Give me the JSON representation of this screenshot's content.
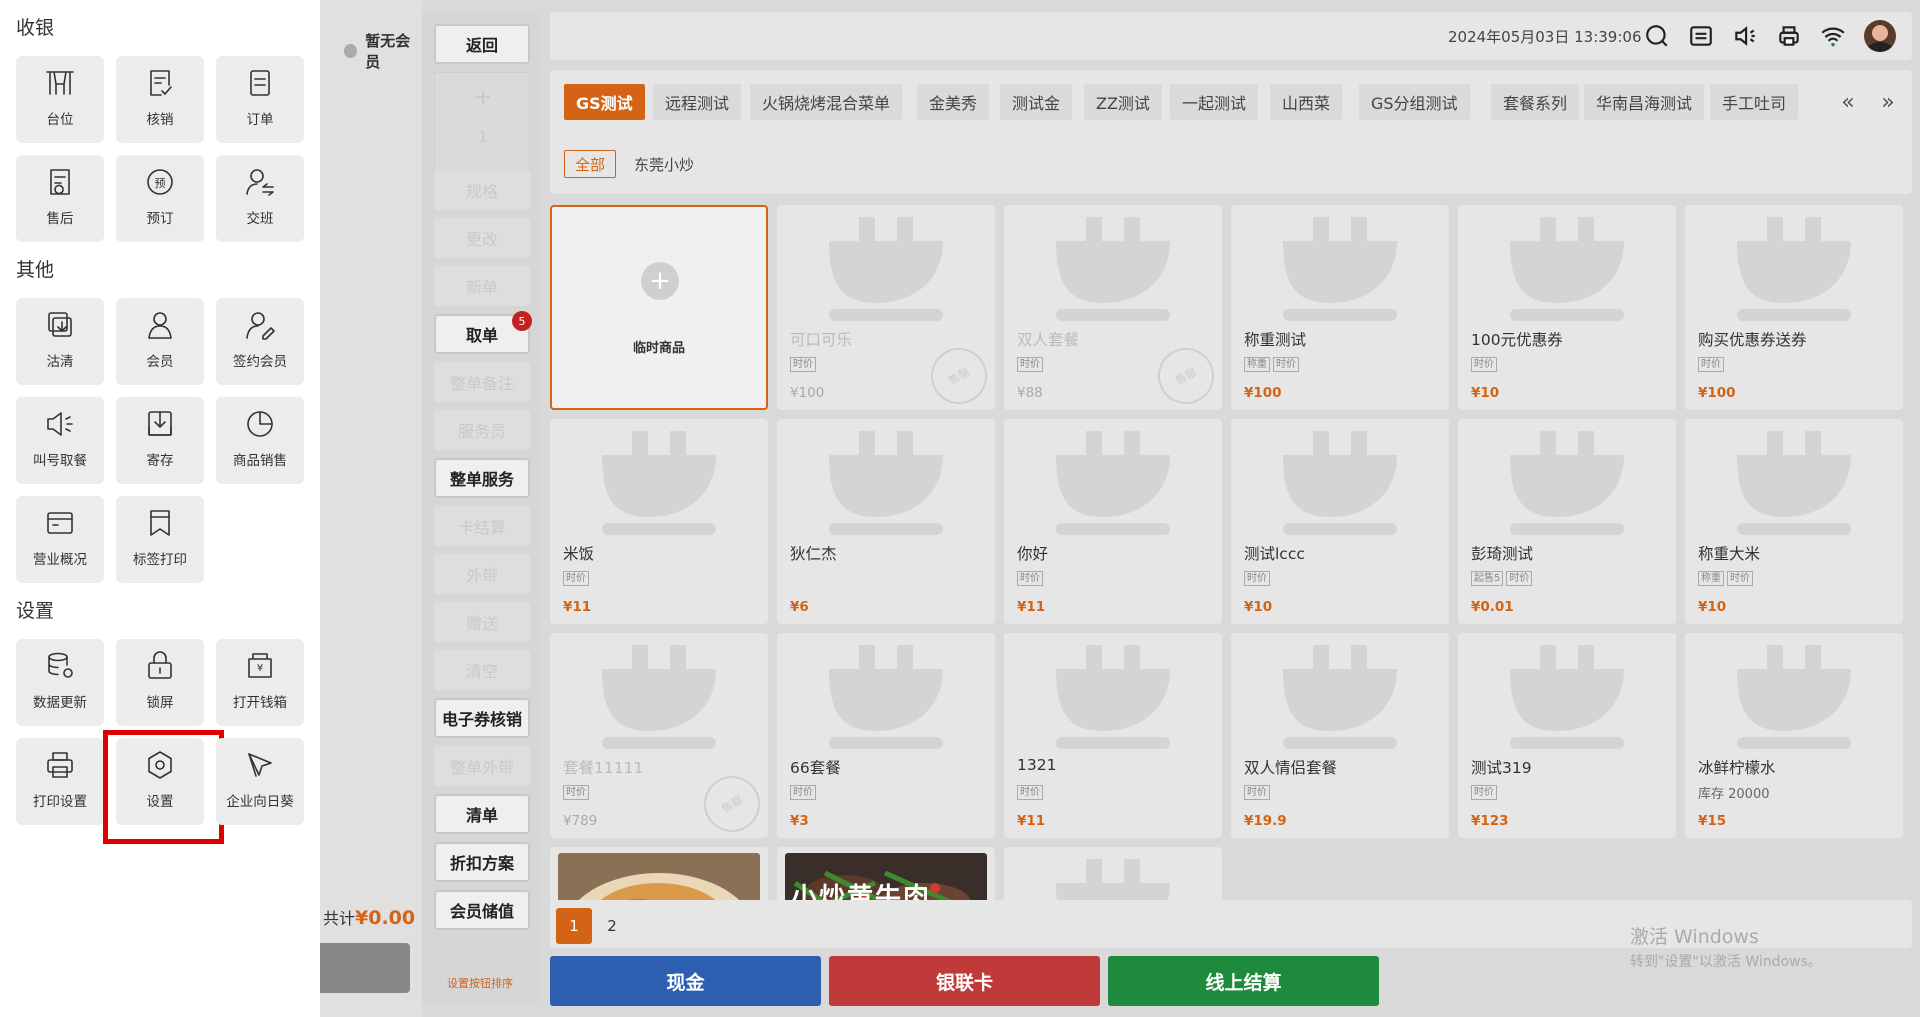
{
  "drawer": {
    "sections": [
      {
        "title": "收银",
        "items": [
          {
            "label": "台位",
            "icon": "table-chair-icon"
          },
          {
            "label": "核销",
            "icon": "verify-icon"
          },
          {
            "label": "订单",
            "icon": "order-icon"
          },
          {
            "label": "售后",
            "icon": "after-sale-icon"
          },
          {
            "label": "预订",
            "icon": "reserve-icon"
          },
          {
            "label": "交班",
            "icon": "shift-handover-icon"
          }
        ]
      },
      {
        "title": "其他",
        "items": [
          {
            "label": "沽清",
            "icon": "clear-stock-icon"
          },
          {
            "label": "会员",
            "icon": "member-icon"
          },
          {
            "label": "签约会员",
            "icon": "contract-member-icon"
          },
          {
            "label": "叫号取餐",
            "icon": "call-number-icon"
          },
          {
            "label": "寄存",
            "icon": "storage-icon"
          },
          {
            "label": "商品销售",
            "icon": "sales-chart-icon"
          },
          {
            "label": "营业概况",
            "icon": "business-overview-icon"
          },
          {
            "label": "标签打印",
            "icon": "label-print-icon"
          }
        ]
      },
      {
        "title": "设置",
        "items": [
          {
            "label": "数据更新",
            "icon": "data-update-icon"
          },
          {
            "label": "锁屏",
            "icon": "lock-screen-icon"
          },
          {
            "label": "打开钱箱",
            "icon": "cash-box-icon"
          },
          {
            "label": "打印设置",
            "icon": "printer-icon"
          },
          {
            "label": "设置",
            "icon": "settings-hexagon-icon",
            "highlight": true
          },
          {
            "label": "企业向日葵",
            "icon": "sunflower-remote-icon"
          }
        ]
      }
    ]
  },
  "member": {
    "label": "暂无会员",
    "total_label": "共计",
    "total_value": "¥0.00"
  },
  "ops": {
    "back": "返回",
    "qty_plus": "+",
    "qty_value": "1",
    "buttons": [
      {
        "label": "规格",
        "active": false
      },
      {
        "label": "更改",
        "active": false
      },
      {
        "label": "新单",
        "active": false
      },
      {
        "label": "取单",
        "active": true,
        "badge": "5"
      },
      {
        "label": "整单备注",
        "active": false
      },
      {
        "label": "服务员",
        "active": false
      },
      {
        "label": "整单服务",
        "active": true
      },
      {
        "label": "卡结算",
        "active": false
      },
      {
        "label": "外带",
        "active": false
      },
      {
        "label": "赠送",
        "active": false
      },
      {
        "label": "清空",
        "active": false
      },
      {
        "label": "电子券核销",
        "active": true
      },
      {
        "label": "整单外带",
        "active": false
      },
      {
        "label": "清单",
        "active": true
      },
      {
        "label": "折扣方案",
        "active": true
      },
      {
        "label": "会员储值",
        "active": true
      }
    ],
    "sort_link": "设置按钮排序"
  },
  "topbar": {
    "datetime": "2024年05月03日 13:39:06"
  },
  "categories": [
    "GS测试",
    "远程测试",
    "火锅烧烤混合菜单",
    "金美秀",
    "测试金",
    "ZZ测试",
    "一起测试",
    "山西菜",
    "GS分组测试",
    "套餐系列",
    "华南昌海测试",
    "手工吐司"
  ],
  "subcategories": {
    "active": "全部",
    "other": "东莞小炒"
  },
  "temp_item": "临时商品",
  "items": [
    {
      "name": "可口可乐",
      "tags": [
        "时价"
      ],
      "price": "¥100",
      "sold": true,
      "stamp": "售罄"
    },
    {
      "name": "双人套餐",
      "tags": [
        "时价"
      ],
      "price": "¥88",
      "sold": true,
      "stamp": "售罄"
    },
    {
      "name": "称重测试",
      "tags": [
        "称重",
        "时价"
      ],
      "price": "¥100"
    },
    {
      "name": "100元优惠券",
      "tags": [
        "时价"
      ],
      "price": "¥10"
    },
    {
      "name": "购买优惠券送券",
      "tags": [
        "时价"
      ],
      "price": "¥100"
    },
    {
      "name": "米饭",
      "tags": [
        "时价"
      ],
      "price": "¥11"
    },
    {
      "name": "狄仁杰",
      "tags": [],
      "price": "¥6"
    },
    {
      "name": "你好",
      "tags": [
        "时价"
      ],
      "price": "¥11"
    },
    {
      "name": "测试lccc",
      "tags": [
        "时价"
      ],
      "price": "¥10"
    },
    {
      "name": "彭琦测试",
      "tags": [
        "起售5",
        "时价"
      ],
      "price": "¥0.01"
    },
    {
      "name": "称重大米",
      "tags": [
        "称重",
        "时价"
      ],
      "price": "¥10"
    },
    {
      "name": "套餐11111",
      "tags": [
        "时价"
      ],
      "price": "¥789",
      "sold": true,
      "stamp": "售罄"
    },
    {
      "name": "66套餐",
      "tags": [
        "时价"
      ],
      "price": "¥3"
    },
    {
      "name": "1321",
      "tags": [
        "时价"
      ],
      "price": "¥11"
    },
    {
      "name": "双人情侣套餐",
      "tags": [
        "时价"
      ],
      "price": "¥19.9"
    },
    {
      "name": "测试319",
      "tags": [
        "时价"
      ],
      "price": "¥123"
    },
    {
      "name": "冰鲜柠檬水",
      "tags": [],
      "stock": "库存  20000",
      "price": "¥15"
    }
  ],
  "photo_caption": "小炒黄牛肉",
  "pager": {
    "pages": [
      "1",
      "2"
    ],
    "watermark_title": "激活 Windows",
    "watermark_sub": "转到\"设置\"以激活 Windows。"
  },
  "pay": {
    "cash": "现金",
    "unionpay": "银联卡",
    "online": "线上结算"
  },
  "colors": {
    "accent": "#d36416",
    "cash": "#2d5fb0",
    "unionpay": "#c03a3a",
    "online": "#1e8a3c",
    "highlight": "#e00000"
  }
}
